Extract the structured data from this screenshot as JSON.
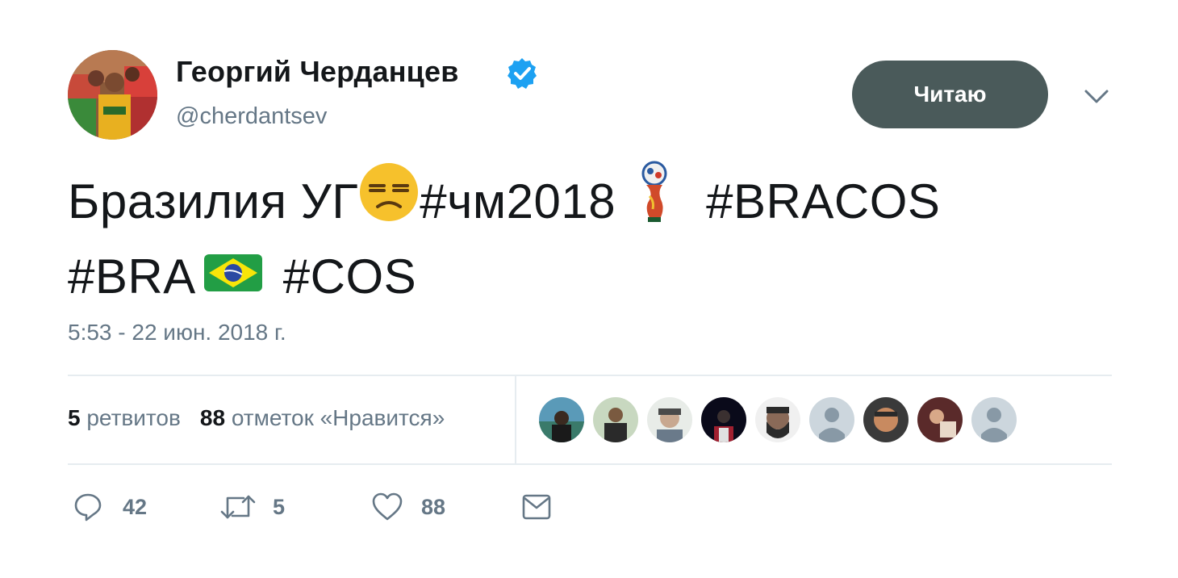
{
  "author": {
    "display_name": "Георгий Черданцев",
    "handle": "@cherdantsev",
    "verified": true,
    "avatar_icon": "user-avatar-photo"
  },
  "follow_button": {
    "label": "Читаю"
  },
  "tweet": {
    "line1": {
      "text1": "Бразилия УГ",
      "emoji1": "unamused-face-emoji",
      "hashtag1": "#чм2018",
      "emoji2": "world-cup-mascot-emoji",
      "hashtag2": "#BRACOS"
    },
    "line2": {
      "hashtag1": "#BRA",
      "emoji1": "brazil-flag-emoji",
      "hashtag2": "#COS"
    }
  },
  "timestamp": "5:53 - 22 июн. 2018 г.",
  "stats": {
    "retweets_count": "5",
    "retweets_label": "ретвитов",
    "likes_count": "88",
    "likes_label": "отметок «Нравится»"
  },
  "likers_count": 9,
  "actions": {
    "reply_count": "42",
    "retweet_count": "5",
    "like_count": "88"
  },
  "colors": {
    "text": "#14171a",
    "muted": "#657786",
    "follow_button_bg": "#4a5a5a",
    "verified_blue": "#1da1f2",
    "divider": "#e6ecf0"
  }
}
